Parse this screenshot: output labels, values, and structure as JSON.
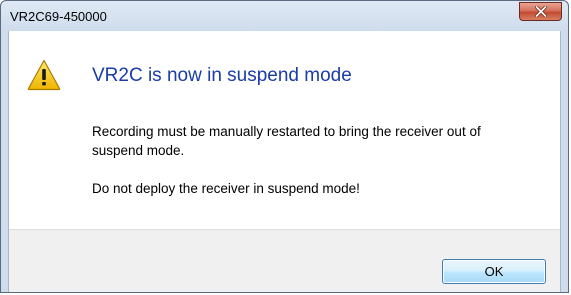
{
  "window": {
    "title": "VR2C69-450000"
  },
  "dialog": {
    "icon": "warning-icon",
    "main_instruction": "VR2C is now in suspend mode",
    "paragraphs": [
      "Recording must be manually restarted to bring the receiver out of suspend mode.",
      "Do not deploy the receiver in suspend mode!"
    ]
  },
  "buttons": {
    "ok_label": "OK"
  },
  "colors": {
    "instruction_text": "#1a3da6",
    "close_button": "#c44a33",
    "warning_fill": "#f5c400"
  }
}
